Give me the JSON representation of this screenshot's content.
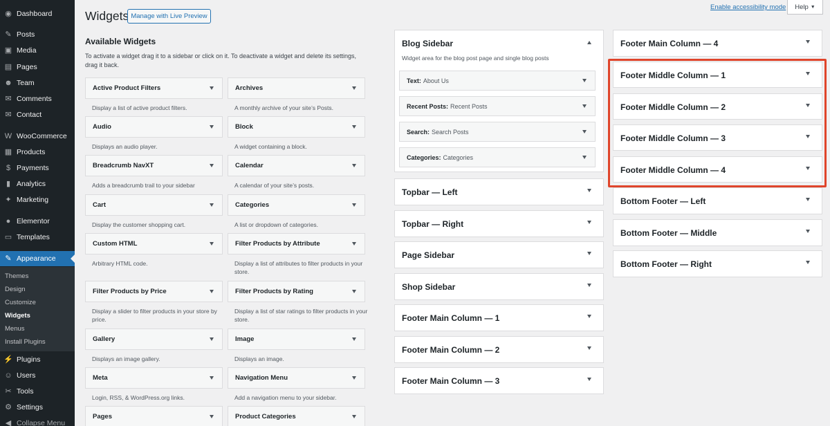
{
  "sidebar": {
    "items": [
      {
        "label": "Dashboard",
        "icon": "dashboard-icon",
        "glyph": "◉"
      },
      {
        "label": "Posts",
        "icon": "pin-icon",
        "glyph": "✎"
      },
      {
        "label": "Media",
        "icon": "media-icon",
        "glyph": "▣"
      },
      {
        "label": "Pages",
        "icon": "pages-icon",
        "glyph": "▤"
      },
      {
        "label": "Team",
        "icon": "team-icon",
        "glyph": "☻"
      },
      {
        "label": "Comments",
        "icon": "comments-icon",
        "glyph": "✉"
      },
      {
        "label": "Contact",
        "icon": "contact-icon",
        "glyph": "✉"
      },
      {
        "label": "WooCommerce",
        "icon": "woocommerce-icon",
        "glyph": "W"
      },
      {
        "label": "Products",
        "icon": "products-icon",
        "glyph": "▦"
      },
      {
        "label": "Payments",
        "icon": "payments-icon",
        "glyph": "$"
      },
      {
        "label": "Analytics",
        "icon": "analytics-icon",
        "glyph": "▮"
      },
      {
        "label": "Marketing",
        "icon": "marketing-icon",
        "glyph": "✦"
      },
      {
        "label": "Elementor",
        "icon": "elementor-icon",
        "glyph": "●"
      },
      {
        "label": "Templates",
        "icon": "templates-icon",
        "glyph": "▭"
      },
      {
        "label": "Appearance",
        "icon": "appearance-icon",
        "glyph": "✎"
      },
      {
        "label": "Plugins",
        "icon": "plugins-icon",
        "glyph": "⚡"
      },
      {
        "label": "Users",
        "icon": "users-icon",
        "glyph": "☺"
      },
      {
        "label": "Tools",
        "icon": "tools-icon",
        "glyph": "✂"
      },
      {
        "label": "Settings",
        "icon": "settings-icon",
        "glyph": "⚙"
      },
      {
        "label": "Collapse Menu",
        "icon": "collapse-icon",
        "glyph": "◀"
      }
    ],
    "submenu": [
      "Themes",
      "Design",
      "Customize",
      "Widgets",
      "Menus",
      "Install Plugins"
    ]
  },
  "header": {
    "accessibility_link": "Enable accessibility mode",
    "help": "Help",
    "title": "Widgets",
    "live_preview": "Manage with Live Preview"
  },
  "available": {
    "title": "Available Widgets",
    "description": "To activate a widget drag it to a sidebar or click on it. To deactivate a widget and delete its settings, drag it back.",
    "widgets": [
      {
        "name": "Active Product Filters",
        "desc": "Display a list of active product filters."
      },
      {
        "name": "Archives",
        "desc": "A monthly archive of your site’s Posts."
      },
      {
        "name": "Audio",
        "desc": "Displays an audio player."
      },
      {
        "name": "Block",
        "desc": "A widget containing a block."
      },
      {
        "name": "Breadcrumb NavXT",
        "desc": "Adds a breadcrumb trail to your sidebar"
      },
      {
        "name": "Calendar",
        "desc": "A calendar of your site’s posts."
      },
      {
        "name": "Cart",
        "desc": "Display the customer shopping cart."
      },
      {
        "name": "Categories",
        "desc": "A list or dropdown of categories."
      },
      {
        "name": "Custom HTML",
        "desc": "Arbitrary HTML code."
      },
      {
        "name": "Filter Products by Attribute",
        "desc": "Display a list of attributes to filter products in your store."
      },
      {
        "name": "Filter Products by Price",
        "desc": "Display a slider to filter products in your store by price."
      },
      {
        "name": "Filter Products by Rating",
        "desc": "Display a list of star ratings to filter products in your store."
      },
      {
        "name": "Gallery",
        "desc": "Displays an image gallery."
      },
      {
        "name": "Image",
        "desc": "Displays an image."
      },
      {
        "name": "Meta",
        "desc": "Login, RSS, & WordPress.org links."
      },
      {
        "name": "Navigation Menu",
        "desc": "Add a navigation menu to your sidebar."
      },
      {
        "name": "Pages",
        "desc": ""
      },
      {
        "name": "Product Categories",
        "desc": ""
      }
    ]
  },
  "blog_sidebar": {
    "title": "Blog Sidebar",
    "description": "Widget area for the blog post page and single blog posts",
    "widgets": [
      {
        "type": "Text:",
        "title": "About Us"
      },
      {
        "type": "Recent Posts:",
        "title": "Recent Posts"
      },
      {
        "type": "Search:",
        "title": "Search Posts"
      },
      {
        "type": "Categories:",
        "title": "Categories"
      }
    ]
  },
  "middle_areas": [
    "Topbar — Left",
    "Topbar — Right",
    "Page Sidebar",
    "Shop Sidebar",
    "Footer Main Column — 1",
    "Footer Main Column — 2",
    "Footer Main Column — 3"
  ],
  "right_areas": [
    "Footer Main Column — 4",
    "Footer Middle Column — 1",
    "Footer Middle Column — 2",
    "Footer Middle Column — 3",
    "Footer Middle Column — 4",
    "Bottom Footer — Left",
    "Bottom Footer — Middle",
    "Bottom Footer — Right"
  ],
  "colors": {
    "sidebar_bg": "#1d2327",
    "accent": "#2271b1",
    "highlight": "#e0452b"
  }
}
